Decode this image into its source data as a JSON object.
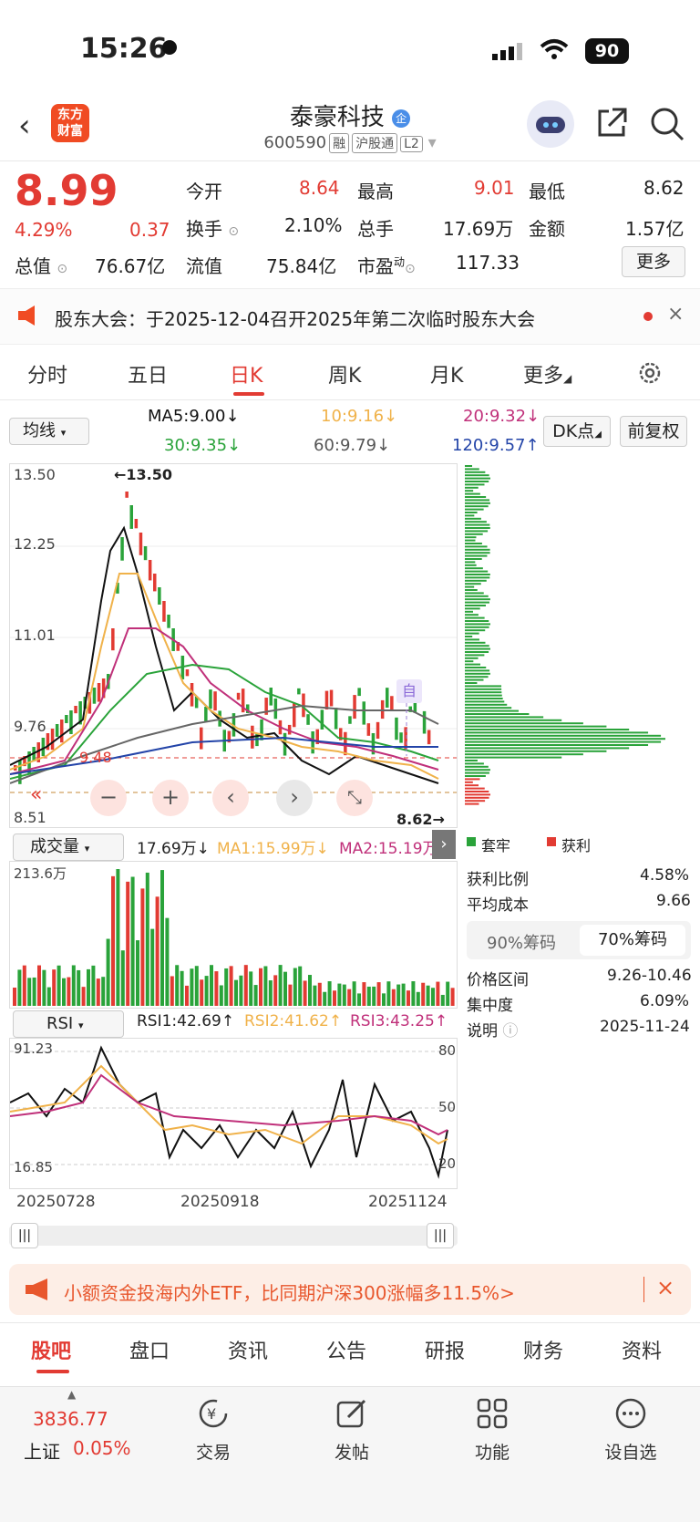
{
  "status": {
    "time": "15:26",
    "battery": "90"
  },
  "header": {
    "logo_line1": "东方",
    "logo_line2": "财富",
    "title": "泰豪科技",
    "title_badge": "企",
    "code": "600590",
    "tags": [
      "融",
      "沪股通",
      "L2"
    ]
  },
  "quote": {
    "price": "8.99",
    "pct": "4.29%",
    "chg": "0.37",
    "f1": {
      "l": "今开",
      "v": "8.64"
    },
    "f2": {
      "l": "最高",
      "v": "9.01"
    },
    "f3": {
      "l": "最低",
      "v": "8.62"
    },
    "f4": {
      "l": "换手",
      "v": "2.10%"
    },
    "f5": {
      "l": "总手",
      "v": "17.69万"
    },
    "f6": {
      "l": "金额",
      "v": "1.57亿"
    },
    "f7": {
      "l": "总值",
      "v": "76.67亿"
    },
    "f8": {
      "l": "流值",
      "v": "75.84亿"
    },
    "f9": {
      "l": "市盈",
      "sup": "动",
      "v": "117.33"
    },
    "more": "更多"
  },
  "notice": {
    "text": "股东大会：于2025-12-04召开2025年第二次临时股东大会"
  },
  "tabs": [
    "分时",
    "五日",
    "日K",
    "周K",
    "月K",
    "更多"
  ],
  "ma": {
    "select": "均线",
    "ma5": "MA5:9.00↓",
    "ma10": "10:9.16↓",
    "ma20": "20:9.32↓",
    "ma30": "30:9.35↓",
    "ma60": "60:9.79↓",
    "ma120": "120:9.57↑",
    "dk": "DK点",
    "fq": "前复权"
  },
  "kchart": {
    "y1": "13.50",
    "y2": "12.25",
    "y3": "11.01",
    "y4": "9.76",
    "y5": "8.51",
    "hi": "←13.50",
    "lo": "8.62→",
    "mid": "9.48",
    "zi": "自"
  },
  "vol": {
    "select": "成交量",
    "v": "17.69万↓",
    "ma1": "MA1:15.99万↓",
    "ma2": "MA2:15.19万↑",
    "top": "213.6万"
  },
  "rsi": {
    "select": "RSI",
    "r1": "RSI1:42.69↑",
    "r2": "RSI2:41.62↑",
    "r3": "RSI3:43.25↑",
    "top": "91.23",
    "bot": "16.85",
    "l80": "80",
    "l50": "50",
    "l20": "20"
  },
  "dates": [
    "20250728",
    "20250918",
    "20251124"
  ],
  "chips": {
    "legend1": "套牢",
    "legend2": "获利",
    "r1": {
      "l": "获利比例",
      "v": "4.58%"
    },
    "r2": {
      "l": "平均成本",
      "v": "9.66"
    },
    "t1": "90%筹码",
    "t2": "70%筹码",
    "r3": {
      "l": "价格区间",
      "v": "9.26-10.46"
    },
    "r4": {
      "l": "集中度",
      "v": "6.09%"
    },
    "r5": {
      "l": "说明",
      "v": "2025-11-24"
    }
  },
  "ad": {
    "text": "小额资金投海内外ETF，比同期沪深300涨幅多11.5%>"
  },
  "btabs": [
    "股吧",
    "盘口",
    "资讯",
    "公告",
    "研报",
    "财务",
    "资料"
  ],
  "nav": {
    "index_val": "3836.77",
    "index_name": "上证",
    "index_pct": "0.05%",
    "n1": "交易",
    "n2": "发帖",
    "n3": "功能",
    "n4": "设自选"
  },
  "chart_data": [
    {
      "type": "line",
      "title": "",
      "series": [
        {
          "name": "RSI1",
          "values": [
            42.69
          ]
        },
        {
          "name": "RSI2",
          "values": [
            41.62
          ]
        },
        {
          "name": "RSI3",
          "values": [
            43.25
          ]
        }
      ],
      "ylim": [
        16.85,
        91.23
      ]
    }
  ]
}
